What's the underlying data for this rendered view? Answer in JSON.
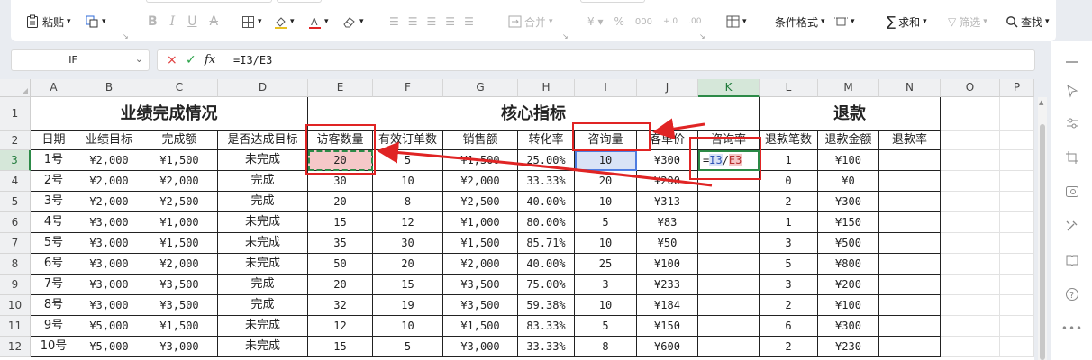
{
  "ribbon": {
    "paste_label": "粘贴",
    "merge_label": "合并",
    "conditional_format_label": "条件格式",
    "sum_label": "求和",
    "filter_label": "筛选",
    "find_label": "查找"
  },
  "formula_bar": {
    "name_box": "IF",
    "cancel_icon": "×",
    "confirm_icon": "✓",
    "fx_label": "fx",
    "formula": "=I3/E3"
  },
  "columns": [
    "A",
    "B",
    "C",
    "D",
    "E",
    "F",
    "G",
    "H",
    "I",
    "J",
    "K",
    "L",
    "M",
    "N",
    "O",
    "P"
  ],
  "selected_column": "K",
  "rows": [
    "1",
    "2",
    "3",
    "4",
    "5",
    "6",
    "7",
    "8",
    "9",
    "10",
    "11",
    "12"
  ],
  "selected_row": "3",
  "sections": {
    "performance": "业绩完成情况",
    "core": "核心指标",
    "refund": "退款"
  },
  "headers": [
    "日期",
    "业绩目标",
    "完成额",
    "是否达成目标",
    "访客数量",
    "有效订单数",
    "销售额",
    "转化率",
    "咨询量",
    "客单价",
    "咨询率",
    "退款笔数",
    "退款金额",
    "退款率"
  ],
  "data_rows": [
    [
      "1号",
      "¥2,000",
      "¥1,500",
      "未完成",
      "20",
      "5",
      "¥1,500",
      "25.00%",
      "10",
      "¥300",
      "",
      "1",
      "¥100",
      ""
    ],
    [
      "2号",
      "¥2,000",
      "¥2,000",
      "完成",
      "30",
      "10",
      "¥2,000",
      "33.33%",
      "20",
      "¥200",
      "",
      "0",
      "¥0",
      ""
    ],
    [
      "3号",
      "¥2,000",
      "¥2,500",
      "完成",
      "20",
      "8",
      "¥2,500",
      "40.00%",
      "10",
      "¥313",
      "",
      "2",
      "¥300",
      ""
    ],
    [
      "4号",
      "¥3,000",
      "¥1,000",
      "未完成",
      "15",
      "12",
      "¥1,000",
      "80.00%",
      "5",
      "¥83",
      "",
      "1",
      "¥150",
      ""
    ],
    [
      "5号",
      "¥3,000",
      "¥1,500",
      "未完成",
      "35",
      "30",
      "¥1,500",
      "85.71%",
      "10",
      "¥50",
      "",
      "3",
      "¥500",
      ""
    ],
    [
      "6号",
      "¥3,000",
      "¥2,000",
      "未完成",
      "50",
      "20",
      "¥2,000",
      "40.00%",
      "25",
      "¥100",
      "",
      "5",
      "¥800",
      ""
    ],
    [
      "7号",
      "¥3,000",
      "¥3,500",
      "完成",
      "20",
      "15",
      "¥3,500",
      "75.00%",
      "3",
      "¥233",
      "",
      "3",
      "¥200",
      ""
    ],
    [
      "8号",
      "¥3,000",
      "¥3,500",
      "完成",
      "32",
      "19",
      "¥3,500",
      "59.38%",
      "10",
      "¥184",
      "",
      "2",
      "¥100",
      ""
    ],
    [
      "9号",
      "¥5,000",
      "¥1,500",
      "未完成",
      "12",
      "10",
      "¥1,500",
      "83.33%",
      "5",
      "¥150",
      "",
      "6",
      "¥300",
      ""
    ],
    [
      "10号",
      "¥5,000",
      "¥3,000",
      "未完成",
      "15",
      "5",
      "¥3,000",
      "33.33%",
      "8",
      "¥600",
      "",
      "2",
      "¥230",
      ""
    ]
  ],
  "editing_cell": {
    "prefix": "=",
    "ref1": "I3",
    "sep": "/",
    "ref2": "E3"
  },
  "colors": {
    "selection": "#2c8a47",
    "annotation": "#e02424",
    "ref_blue": "#4e7ce0",
    "ref_red": "#f5c8c8"
  }
}
